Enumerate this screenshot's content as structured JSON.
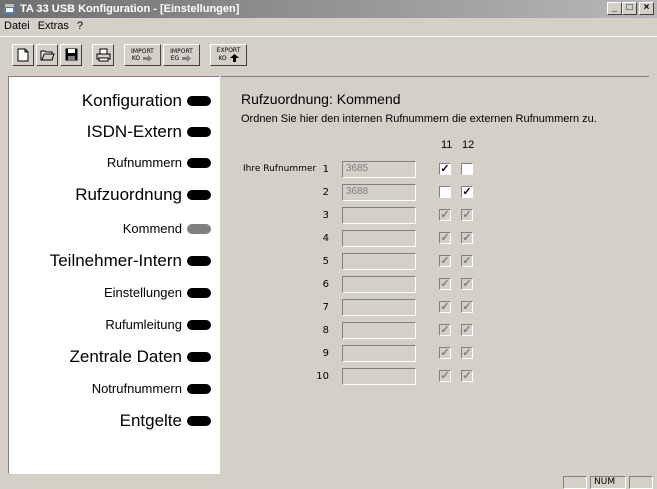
{
  "window": {
    "title": "TA 33 USB Konfiguration - [Einstellungen]"
  },
  "menu": [
    "Datei",
    "Extras",
    "?"
  ],
  "toolbar": {
    "import_ko": {
      "line1": "IMPORT",
      "line2": "KO"
    },
    "import_eg": {
      "line1": "IMPORT",
      "line2": "EG"
    },
    "export_ko": {
      "line1": "EXPORT",
      "line2": "KO"
    }
  },
  "nav": [
    {
      "label": "Konfiguration"
    },
    {
      "label": "ISDN-Extern"
    },
    {
      "label": "Rufnummern"
    },
    {
      "label": "Rufzuordnung"
    },
    {
      "label": "Kommend"
    },
    {
      "label": "Teilnehmer-Intern"
    },
    {
      "label": "Einstellungen"
    },
    {
      "label": "Rufumleitung"
    },
    {
      "label": "Zentrale Daten"
    },
    {
      "label": "Notrufnummern"
    },
    {
      "label": "Entgelte"
    }
  ],
  "main": {
    "heading": "Rufzuordnung: Kommend",
    "description": "Ordnen Sie hier den internen Rufnummern die externen Rufnummern zu.",
    "col1": "11",
    "col2": "12",
    "row_label": "Ihre Rufnummer",
    "rows": [
      {
        "num": "1",
        "value": "3685",
        "c1": true,
        "c2": false,
        "enabled": true
      },
      {
        "num": "2",
        "value": "3688",
        "c1": false,
        "c2": true,
        "enabled": true
      },
      {
        "num": "3",
        "value": "",
        "c1": true,
        "c2": true,
        "enabled": false
      },
      {
        "num": "4",
        "value": "",
        "c1": true,
        "c2": true,
        "enabled": false
      },
      {
        "num": "5",
        "value": "",
        "c1": true,
        "c2": true,
        "enabled": false
      },
      {
        "num": "6",
        "value": "",
        "c1": true,
        "c2": true,
        "enabled": false
      },
      {
        "num": "7",
        "value": "",
        "c1": true,
        "c2": true,
        "enabled": false
      },
      {
        "num": "8",
        "value": "",
        "c1": true,
        "c2": true,
        "enabled": false
      },
      {
        "num": "9",
        "value": "",
        "c1": true,
        "c2": true,
        "enabled": false
      },
      {
        "num": "10",
        "value": "",
        "c1": true,
        "c2": true,
        "enabled": false
      }
    ]
  },
  "status": {
    "num": "NUM"
  }
}
